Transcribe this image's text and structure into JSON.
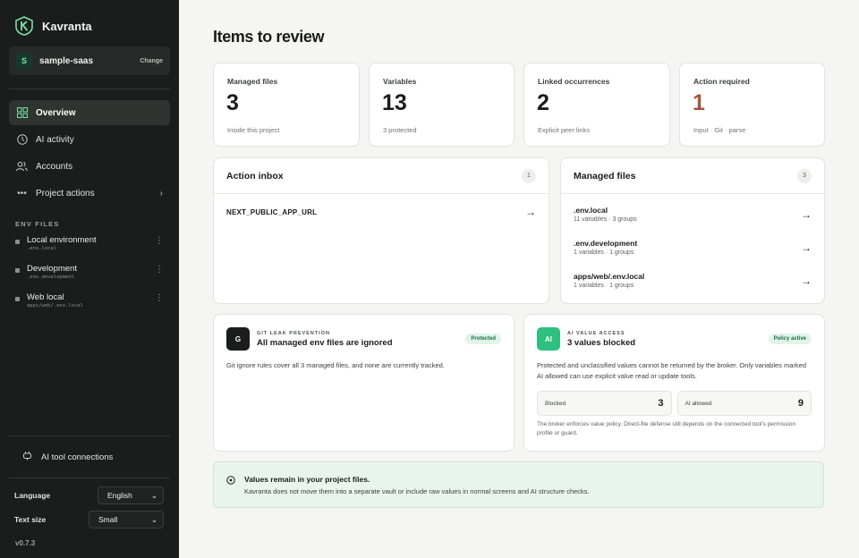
{
  "app": {
    "name": "Kavranta"
  },
  "project": {
    "initial": "S",
    "name": "sample-saas",
    "change_label": "Change"
  },
  "nav": {
    "overview": "Overview",
    "ai_activity": "AI activity",
    "accounts": "Accounts",
    "project_actions": "Project actions"
  },
  "env_files": {
    "label": "ENV FILES",
    "items": [
      {
        "name": "Local environment",
        "file": ".env.local"
      },
      {
        "name": "Development",
        "file": ".env.development"
      },
      {
        "name": "Web local",
        "file": "apps/web/.env.local"
      }
    ]
  },
  "sidebar_footer": {
    "ai_tool_connections": "AI tool connections",
    "language_label": "Language",
    "language_value": "English",
    "text_size_label": "Text size",
    "text_size_value": "Small",
    "version": "v0.7.3"
  },
  "page": {
    "title": "Items to review"
  },
  "stats": [
    {
      "label": "Managed files",
      "value": "3",
      "sub": "Inside this project"
    },
    {
      "label": "Variables",
      "value": "13",
      "sub": "3 protected"
    },
    {
      "label": "Linked occurrences",
      "value": "2",
      "sub": "Explicit peer links"
    },
    {
      "label": "Action required",
      "value": "1",
      "sub": "Input · Git · parse"
    }
  ],
  "action_inbox": {
    "title": "Action inbox",
    "count": "1",
    "items": [
      {
        "key": "NEXT_PUBLIC_APP_URL"
      }
    ]
  },
  "managed_files": {
    "title": "Managed files",
    "count": "3",
    "items": [
      {
        "name": ".env.local",
        "meta": "11 variables · 3 groups"
      },
      {
        "name": ".env.development",
        "meta": "1 variables · 1 groups"
      },
      {
        "name": "apps/web/.env.local",
        "meta": "1 variables · 1 groups"
      }
    ]
  },
  "git_leak": {
    "icon_letter": "G",
    "eyebrow": "GIT LEAK PREVENTION",
    "title": "All managed env files are ignored",
    "status": "Protected",
    "body": "Git ignore rules cover all 3 managed files, and none are currently tracked."
  },
  "ai_access": {
    "icon_letter": "AI",
    "eyebrow": "AI VALUE ACCESS",
    "title": "3 values blocked",
    "status": "Policy active",
    "body": "Protected and unclassified values cannot be returned by the broker. Only variables marked AI allowed can use explicit value read or update tools.",
    "blocked_label": "Blocked",
    "blocked_value": "3",
    "allowed_label": "AI allowed",
    "allowed_value": "9",
    "fine_print": "The broker enforces value policy. Direct-file defense still depends on the connected tool's permission profile or guard."
  },
  "note": {
    "title": "Values remain in your project files.",
    "body": "Kavranta does not move them into a separate vault or include raw values in normal screens and AI structure checks."
  },
  "colors": {
    "accent": "#2fbf7e",
    "warning": "#a5563d",
    "sidebar": "#1a1d1c"
  }
}
